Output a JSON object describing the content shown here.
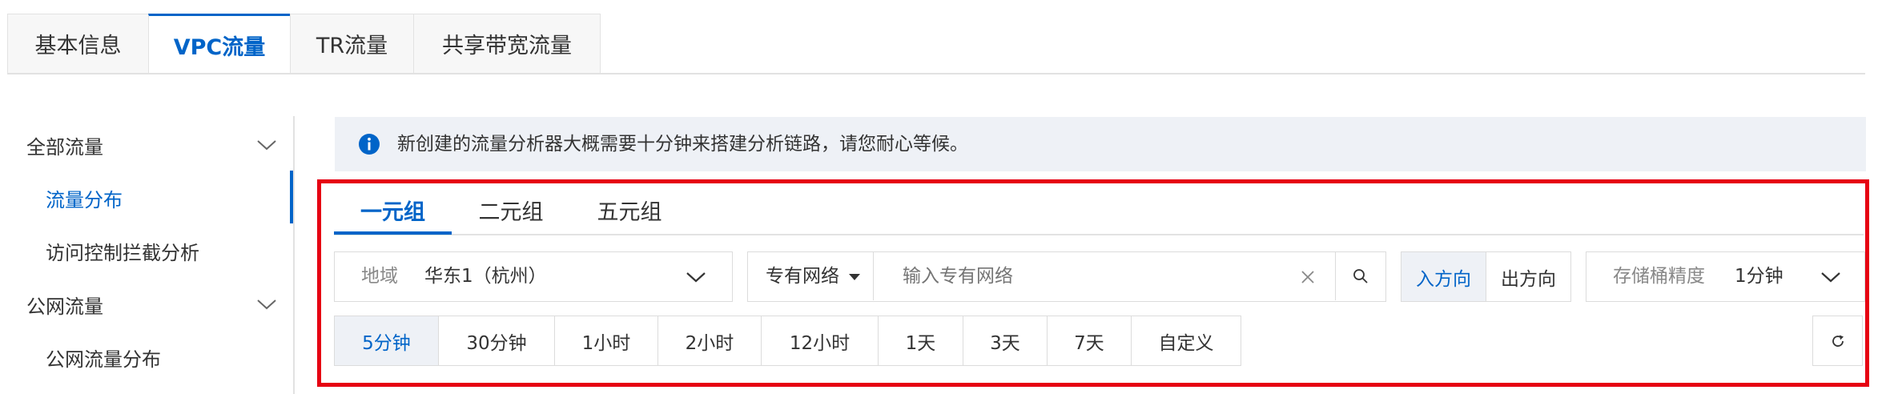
{
  "top_tabs": [
    {
      "label": "基本信息",
      "active": false
    },
    {
      "label": "VPC流量",
      "active": true
    },
    {
      "label": "TR流量",
      "active": false
    },
    {
      "label": "共享带宽流量",
      "active": false
    }
  ],
  "sidebar": {
    "groups": [
      {
        "label": "全部流量",
        "expanded": true,
        "items": [
          "流量分布",
          "访问控制拦截分析"
        ]
      },
      {
        "label": "公网流量",
        "expanded": true,
        "items": [
          "公网流量分布"
        ]
      }
    ],
    "active_item": "流量分布"
  },
  "notice": {
    "icon": "info-icon",
    "text": "新创建的流量分析器大概需要十分钟来搭建分析链路，请您耐心等候。"
  },
  "inner_tabs": [
    {
      "label": "一元组",
      "active": true
    },
    {
      "label": "二元组",
      "active": false
    },
    {
      "label": "五元组",
      "active": false
    }
  ],
  "filters": {
    "region_label": "地域",
    "region_value": "华东1（杭州）",
    "network_type": "专有网络",
    "network_placeholder": "输入专有网络",
    "direction": {
      "in": "入方向",
      "out": "出方向",
      "selected": "入方向"
    },
    "bucket_label": "存储桶精度",
    "bucket_value": "1分钟"
  },
  "time_range": {
    "options": [
      "5分钟",
      "30分钟",
      "1小时",
      "2小时",
      "12小时",
      "1天",
      "3天",
      "7天",
      "自定义"
    ],
    "selected": "5分钟"
  },
  "colors": {
    "accent": "#0064c8",
    "highlight_border": "#e60012",
    "notice_bg": "#eef1f6"
  }
}
